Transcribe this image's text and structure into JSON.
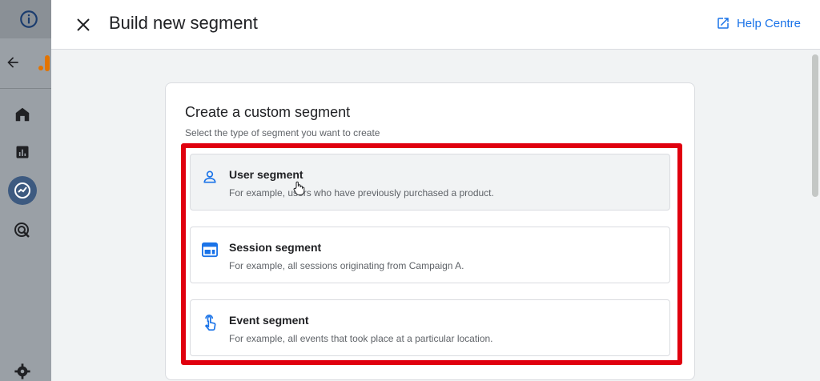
{
  "header": {
    "title": "Build new segment",
    "help_label": "Help Centre"
  },
  "card": {
    "title": "Create a custom segment",
    "subtitle": "Select the type of segment you want to create"
  },
  "options": [
    {
      "title": "User segment",
      "description": "For example, users who have previously purchased a product.",
      "icon": "person-icon"
    },
    {
      "title": "Session segment",
      "description": "For example, all sessions originating from Campaign A.",
      "icon": "session-icon"
    },
    {
      "title": "Event segment",
      "description": "For example, all events that took place at a particular location.",
      "icon": "touch-icon"
    }
  ],
  "colors": {
    "accent": "#1a73e8",
    "highlight": "#e0000f"
  }
}
